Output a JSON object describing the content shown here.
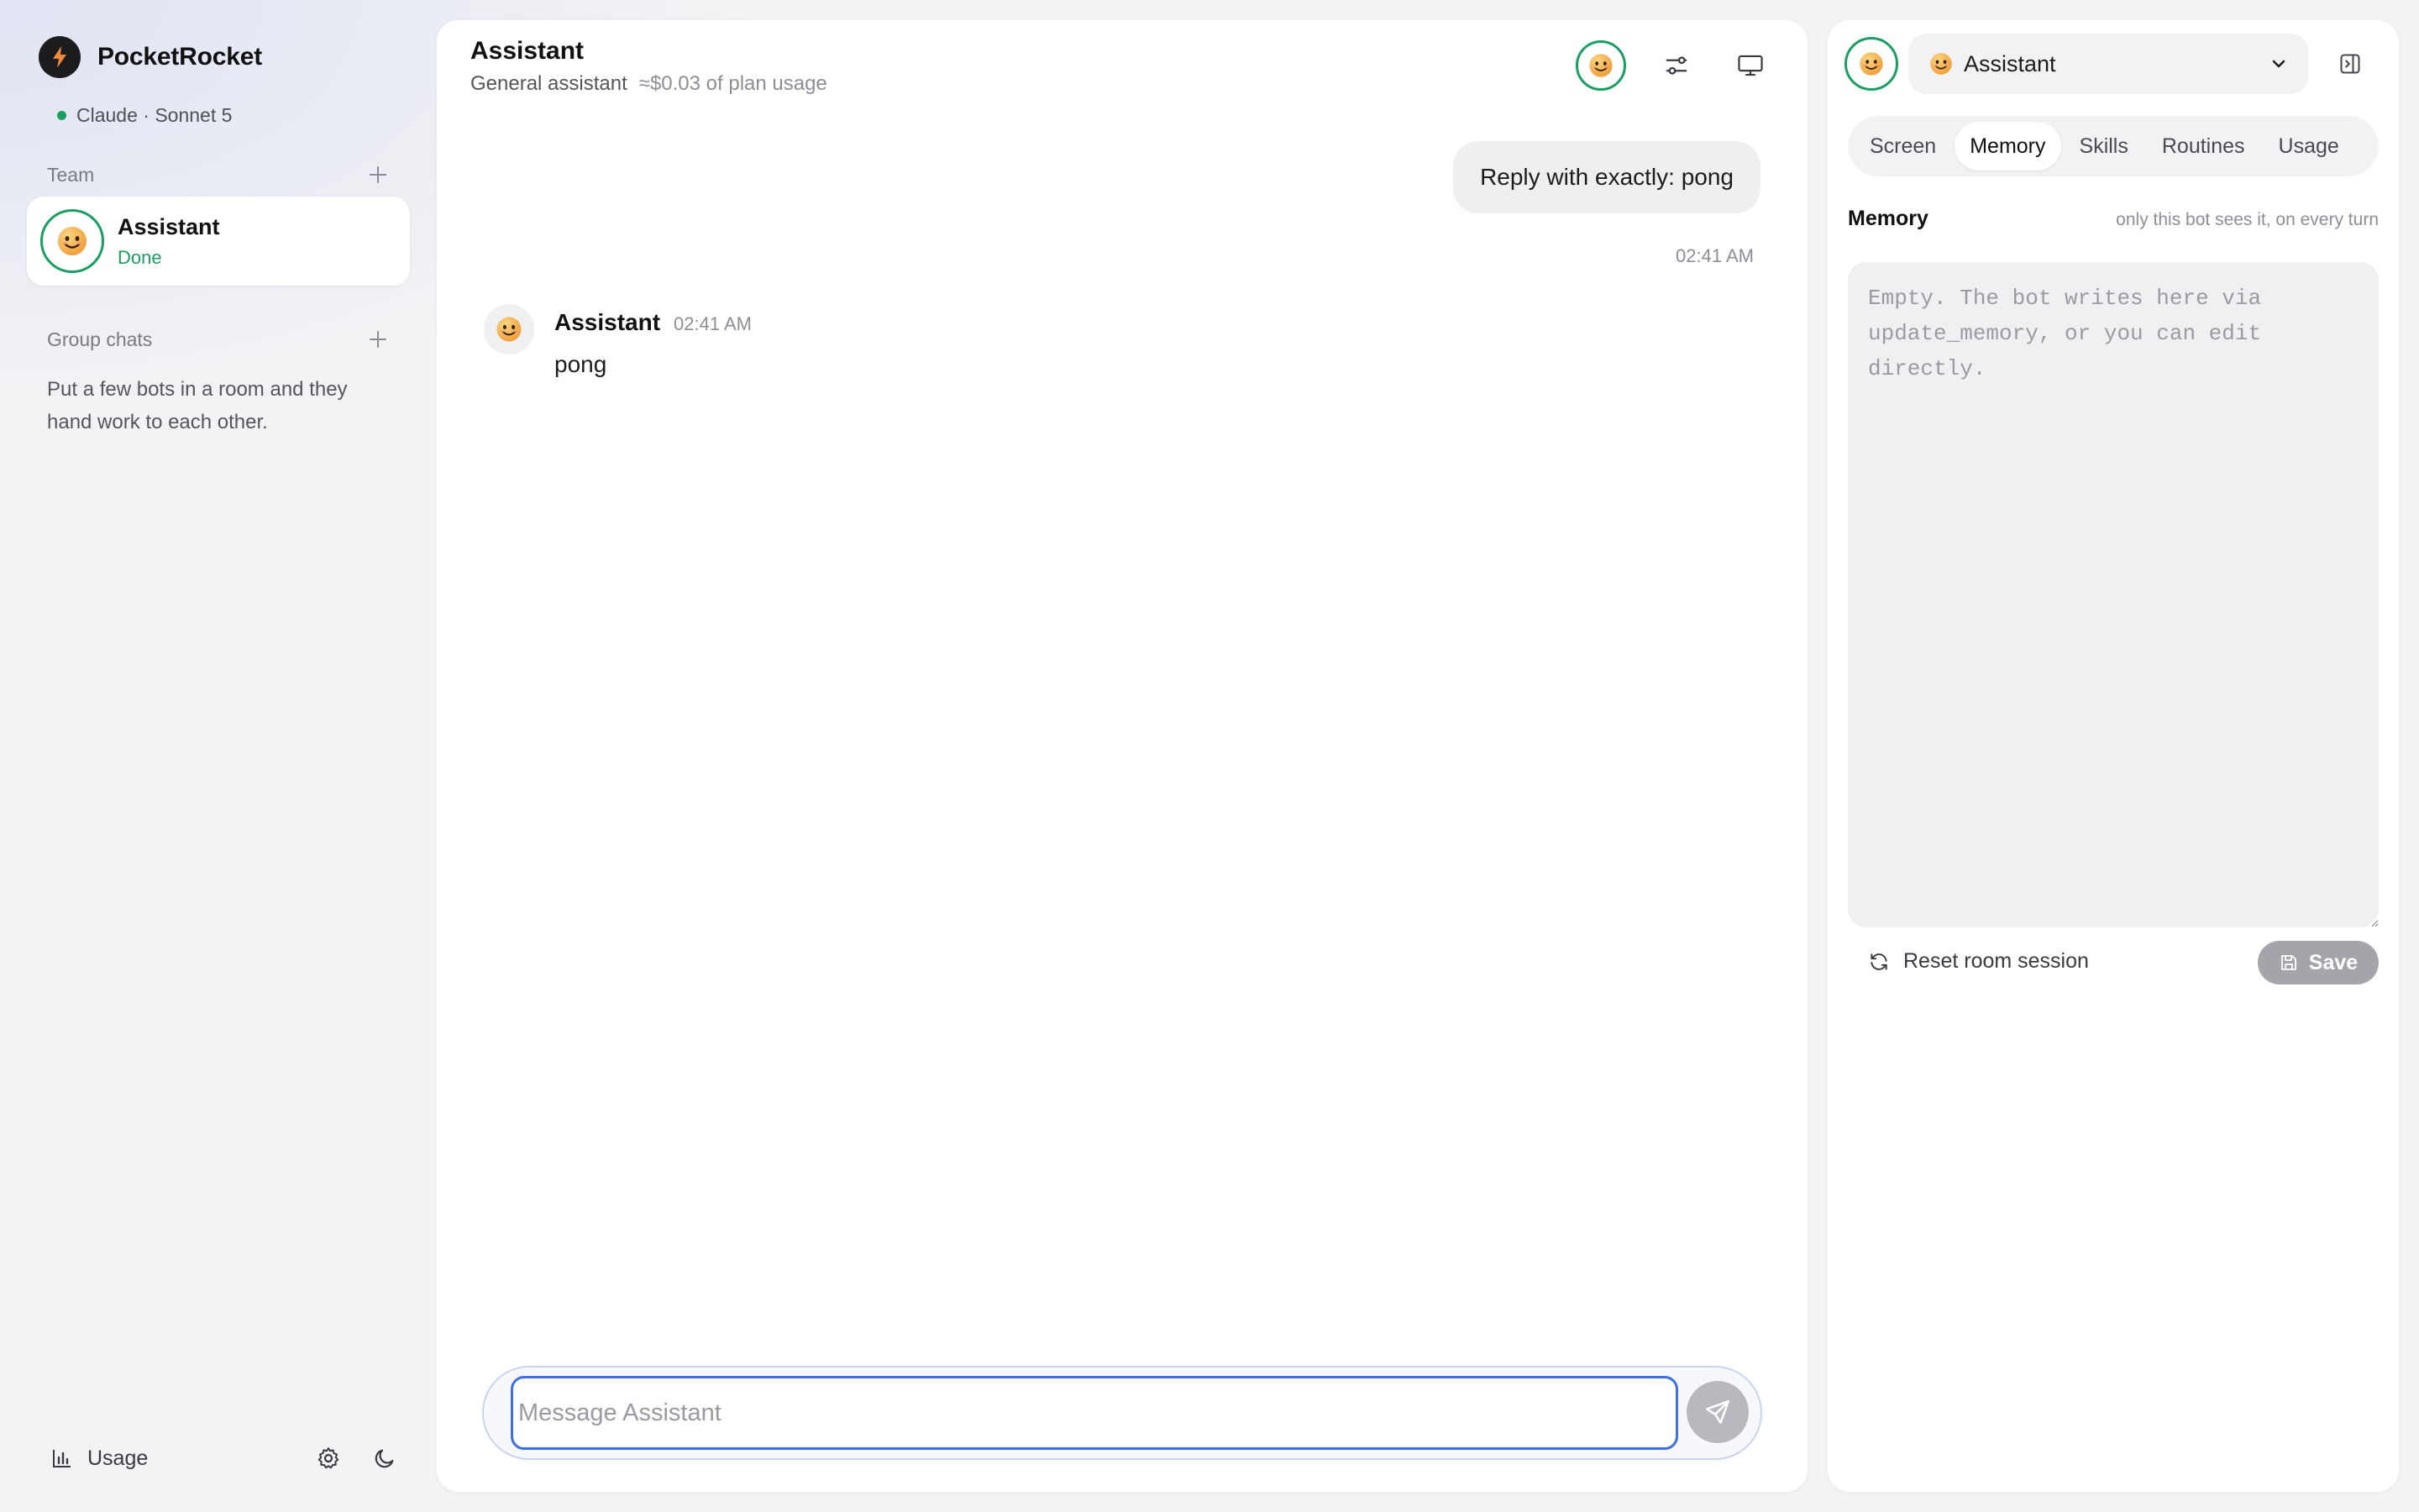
{
  "app": {
    "name": "PocketRocket",
    "model": "Claude · Sonnet 5"
  },
  "sidebar": {
    "team_label": "Team",
    "team_items": [
      {
        "name": "Assistant",
        "status": "Done"
      }
    ],
    "group_label": "Group chats",
    "group_empty": "Put a few bots in a room and they hand work to each other.",
    "footer": {
      "usage_label": "Usage"
    }
  },
  "chat": {
    "title": "Assistant",
    "subtitle": "General assistant",
    "cost": "≈$0.03 of plan usage",
    "messages": [
      {
        "role": "user",
        "text": "Reply with exactly: pong",
        "time": "02:41 AM"
      },
      {
        "role": "bot",
        "name": "Assistant",
        "text": "pong",
        "time": "02:41 AM"
      }
    ],
    "composer_placeholder": "Message Assistant"
  },
  "panel": {
    "selected_bot": "Assistant",
    "tabs": [
      {
        "label": "Screen",
        "active": false
      },
      {
        "label": "Memory",
        "active": true
      },
      {
        "label": "Skills",
        "active": false
      },
      {
        "label": "Routines",
        "active": false
      },
      {
        "label": "Usage",
        "active": false
      }
    ],
    "memory_title": "Memory",
    "memory_hint": "only this bot sees it, on every turn",
    "memory_value": "",
    "memory_placeholder": "Empty. The bot writes here via update_memory, or you can edit directly.",
    "reset_label": "Reset room session",
    "save_label": "Save"
  },
  "colors": {
    "accent_green": "#1a9e62",
    "focus_blue": "#3f6fe0",
    "panel_bg": "#ffffff",
    "app_bg": "#f3f3f5"
  },
  "icons": [
    "bolt-icon",
    "plus-icon",
    "smiley-icon",
    "sliders-icon",
    "monitor-icon",
    "send-icon",
    "chevron-down-icon",
    "panel-collapse-icon",
    "refresh-icon",
    "save-icon",
    "bar-chart-icon",
    "gear-icon",
    "moon-icon"
  ]
}
